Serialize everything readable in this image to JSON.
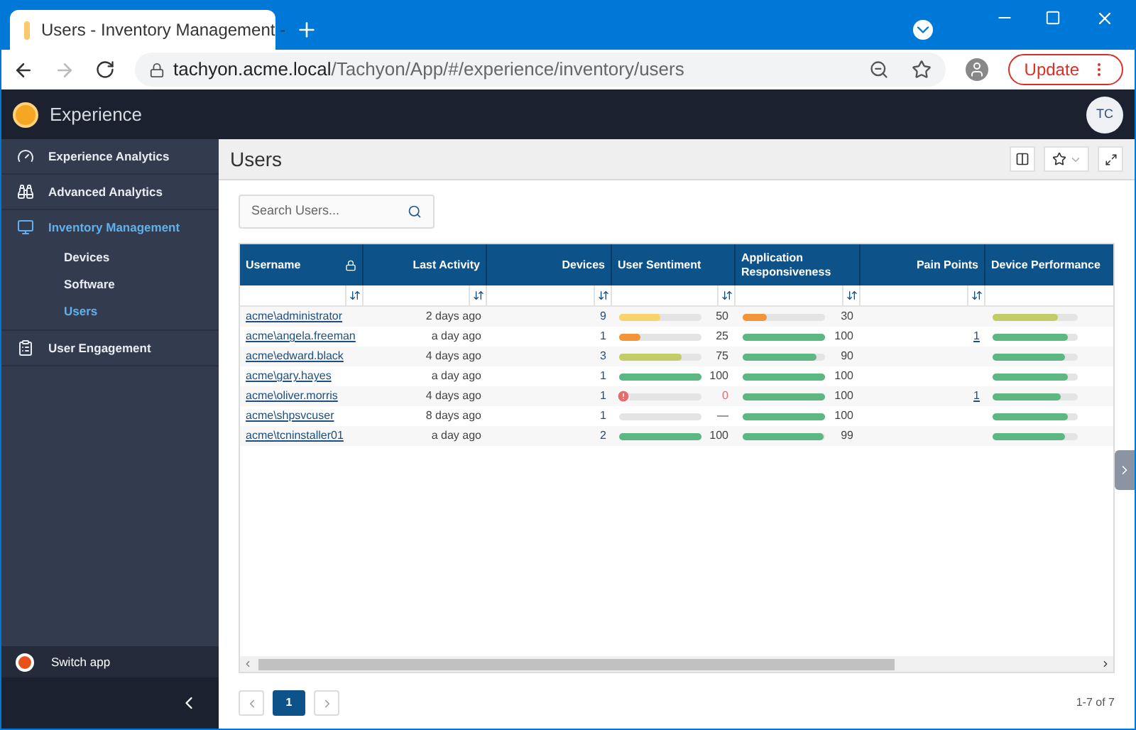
{
  "browser": {
    "tab_title": "Users - Inventory Management -",
    "url_host": "tachyon.acme.local",
    "url_path": "/Tachyon/App/#/experience/inventory/users",
    "update_label": "Update"
  },
  "app": {
    "name": "Experience",
    "avatar": "TC"
  },
  "sidebar": {
    "items": [
      {
        "label": "Experience Analytics",
        "selected": false
      },
      {
        "label": "Advanced Analytics",
        "selected": false
      },
      {
        "label": "Inventory Management",
        "selected": true,
        "children": [
          {
            "label": "Devices",
            "selected": false
          },
          {
            "label": "Software",
            "selected": false
          },
          {
            "label": "Users",
            "selected": true
          }
        ]
      },
      {
        "label": "User Engagement",
        "selected": false
      }
    ],
    "switch_app": "Switch app"
  },
  "page": {
    "title": "Users",
    "search": {
      "placeholder": "Search Users..."
    },
    "table": {
      "columns": [
        {
          "label": "Username",
          "locked": true,
          "sortable": true
        },
        {
          "label": "Last Activity",
          "locked": false,
          "sortable": true
        },
        {
          "label": "Devices",
          "locked": false,
          "sortable": true
        },
        {
          "label": "User Sentiment",
          "locked": false,
          "sortable": true
        },
        {
          "label": "Application Responsiveness",
          "locked": false,
          "sortable": true
        },
        {
          "label": "Pain Points",
          "locked": false,
          "sortable": true
        },
        {
          "label": "Device Performance",
          "locked": false,
          "sortable": false
        }
      ],
      "rows": [
        {
          "username": "acme\\administrator",
          "last_activity": "2 days ago",
          "devices": "9",
          "sentiment": {
            "level": 0.5,
            "reading": "50",
            "alert": false
          },
          "responsiveness": {
            "level": 0.3,
            "reading": "30"
          },
          "performance": {
            "level": 0.77
          }
        },
        {
          "username": "acme\\angela.freeman",
          "last_activity": "a day ago",
          "devices": "1",
          "sentiment": {
            "level": 0.25,
            "reading": "25",
            "alert": false
          },
          "responsiveness": {
            "level": 1,
            "reading": "100"
          },
          "pain_points": "1",
          "performance": {
            "level": 0.88
          }
        },
        {
          "username": "acme\\edward.black",
          "last_activity": "4 days ago",
          "devices": "3",
          "sentiment": {
            "level": 0.75,
            "reading": "75",
            "alert": false
          },
          "responsiveness": {
            "level": 0.9,
            "reading": "90"
          },
          "performance": {
            "level": 0.85
          }
        },
        {
          "username": "acme\\gary.hayes",
          "last_activity": "a day ago",
          "devices": "1",
          "sentiment": {
            "level": 1,
            "reading": "100",
            "alert": false
          },
          "responsiveness": {
            "level": 1,
            "reading": "100"
          },
          "performance": {
            "level": 0.88
          }
        },
        {
          "username": "acme\\oliver.morris",
          "last_activity": "4 days ago",
          "devices": "1",
          "sentiment": {
            "level": 0,
            "reading": "0",
            "alert": true
          },
          "responsiveness": {
            "level": 1,
            "reading": "100"
          },
          "pain_points": "1",
          "performance": {
            "level": 0.8
          }
        },
        {
          "username": "acme\\shpsvcuser",
          "last_activity": "8 days ago",
          "devices": "1",
          "sentiment": {
            "level": 0,
            "reading": "—",
            "alert": false
          },
          "responsiveness": {
            "level": 1,
            "reading": "100"
          },
          "performance": {
            "level": 0.88
          }
        },
        {
          "username": "acme\\tcninstaller01",
          "last_activity": "a day ago",
          "devices": "2",
          "sentiment": {
            "level": 1,
            "reading": "100",
            "alert": false
          },
          "responsiveness": {
            "level": 0.99,
            "reading": "99"
          },
          "performance": {
            "level": 0.85
          }
        }
      ]
    },
    "pagination": {
      "pages": [
        {
          "label": "1",
          "selected": true
        }
      ],
      "summary": "1-7 of 7"
    }
  }
}
